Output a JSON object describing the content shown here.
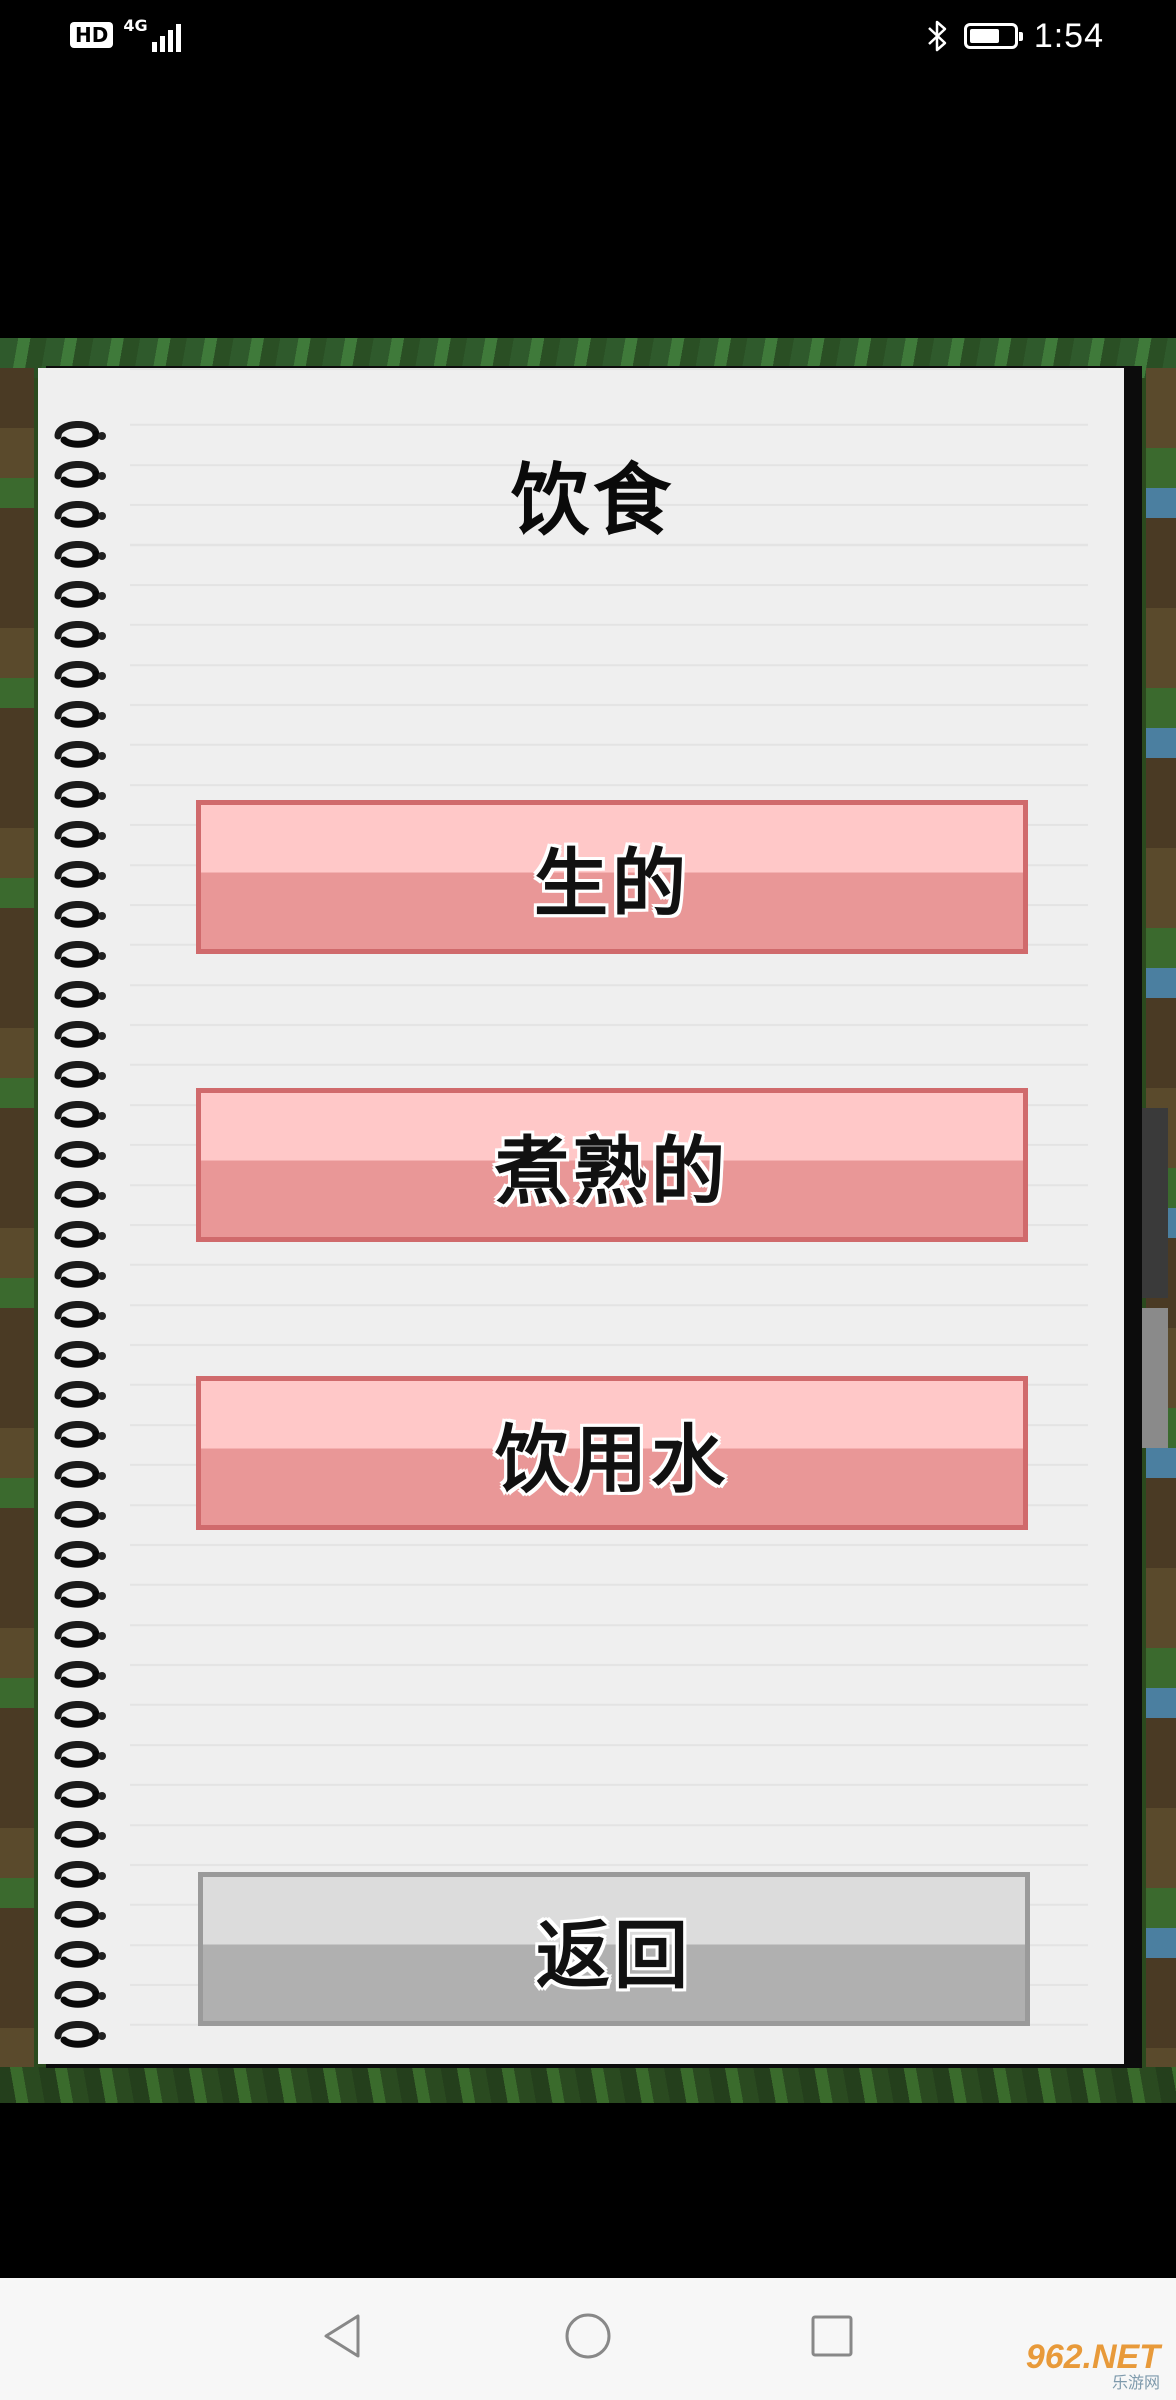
{
  "status_bar": {
    "hd": "HD",
    "network": "4G",
    "signal_level": 4,
    "battery_level": 0.7,
    "time": "1:54"
  },
  "dialog": {
    "title": "饮食",
    "options": [
      {
        "label": "生的"
      },
      {
        "label": "煮熟的"
      },
      {
        "label": "饮用水"
      }
    ],
    "back_label": "返回"
  },
  "navigation_bar": {
    "back": "back-triangle-icon",
    "home": "home-circle-icon",
    "recents": "recents-square-icon"
  },
  "watermark": {
    "main": "962.NET",
    "sub": "乐游网"
  },
  "colors": {
    "pink_top": "#ffc8c8",
    "pink_bottom": "#e99797",
    "pink_border": "#d06a6c",
    "gray_top": "#dcdcdc",
    "gray_bottom": "#b0b0b0",
    "paper": "#efefef"
  }
}
